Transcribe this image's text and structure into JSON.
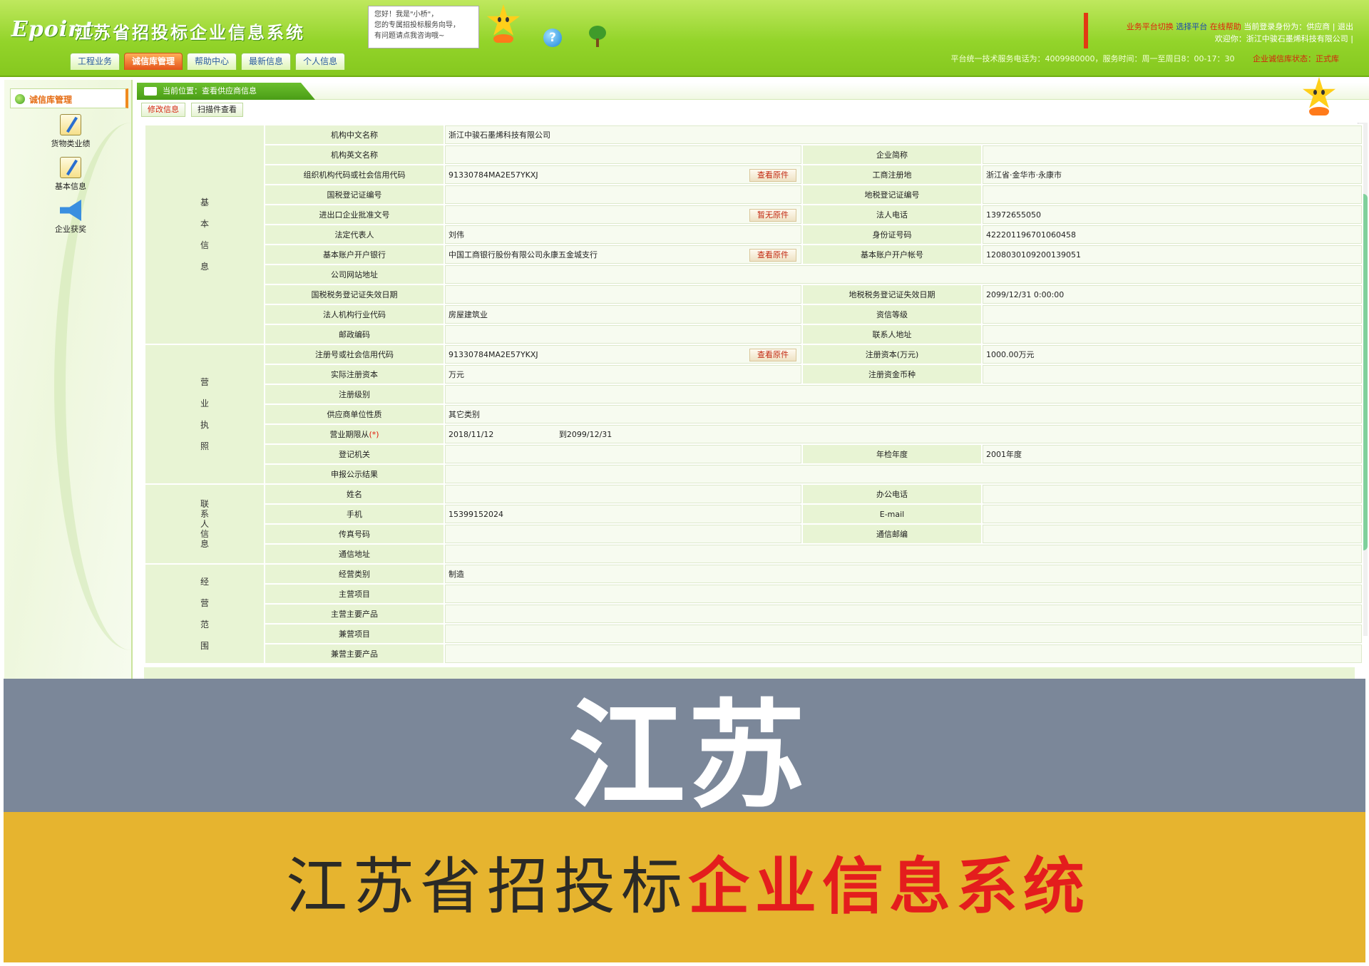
{
  "header": {
    "logo": "Epoint",
    "system_title": "江苏省招投标企业信息系统",
    "helper_bubble": [
      "您好！我是\"小桥\"，",
      "您的专属招投标服务向导，",
      "有问题请点我咨询哦~"
    ],
    "help_icon": "?",
    "top_links": {
      "switch_platform": "业务平台切换",
      "select_platform": "选择平台",
      "online_help": "在线帮助",
      "identity": "当前登录身份为：供应商",
      "logout": "退出",
      "welcome": "欢迎你：浙江中骏石墨烯科技有限公司"
    },
    "service_line": "平台统一技术服务电话为：4009980000，服务时间：周一至周日8：00-17：30",
    "credit_status": "企业诚信库状态：正式库",
    "tabs": [
      {
        "label": "工程业务",
        "active": false
      },
      {
        "label": "诚信库管理",
        "active": true
      },
      {
        "label": "帮助中心",
        "active": false
      },
      {
        "label": "最新信息",
        "active": false
      },
      {
        "label": "个人信息",
        "active": false
      }
    ]
  },
  "sidebar": {
    "title": "诚信库管理",
    "items": [
      {
        "label": "货物类业绩",
        "icon": "edit-note-icon"
      },
      {
        "label": "基本信息",
        "icon": "edit-note-icon"
      },
      {
        "label": "企业获奖",
        "icon": "megaphone-icon"
      }
    ]
  },
  "main": {
    "breadcrumb": "当前位置：查看供应商信息",
    "toolbar": {
      "edit": "修改信息",
      "scan": "扫描件查看"
    },
    "buttons": {
      "view_original": "查看原件",
      "no_original": "暂无原件"
    },
    "sections": {
      "basic": [
        "基",
        "本",
        "信",
        "息"
      ],
      "license": [
        "营",
        "业",
        "执",
        "照"
      ],
      "contact": [
        "联",
        "系",
        "人",
        "信",
        "息"
      ],
      "scope": [
        "经",
        "营",
        "范",
        "围"
      ]
    },
    "rows": {
      "cn_name": {
        "label": "机构中文名称",
        "value": "浙江中骏石墨烯科技有限公司"
      },
      "en_name": {
        "label": "机构英文名称",
        "value": ""
      },
      "short_name": {
        "label": "企业简称",
        "value": ""
      },
      "org_code": {
        "label": "组织机构代码或社会信用代码",
        "value": "91330784MA2E57YKXJ"
      },
      "reg_place": {
        "label": "工商注册地",
        "value": "浙江省·金华市·永康市"
      },
      "nat_tax": {
        "label": "国税登记证编号",
        "value": ""
      },
      "local_tax": {
        "label": "地税登记证编号",
        "value": ""
      },
      "import_export": {
        "label": "进出口企业批准文号",
        "value": ""
      },
      "legal_phone": {
        "label": "法人电话",
        "value": "13972655050"
      },
      "legal_rep": {
        "label": "法定代表人",
        "value": "刘伟"
      },
      "id_no": {
        "label": "身份证号码",
        "value": "422201196701060458"
      },
      "bank": {
        "label": "基本账户开户银行",
        "value": "中国工商银行股份有限公司永康五金城支行"
      },
      "bank_acct": {
        "label": "基本账户开户帐号",
        "value": "1208030109200139051"
      },
      "website": {
        "label": "公司网站地址",
        "value": ""
      },
      "nat_tax_exp": {
        "label": "国税税务登记证失效日期",
        "value": ""
      },
      "local_tax_exp": {
        "label": "地税税务登记证失效日期",
        "value": "2099/12/31 0:00:00"
      },
      "industry": {
        "label": "法人机构行业代码",
        "value": "房屋建筑业"
      },
      "qualification": {
        "label": "资信等级",
        "value": ""
      },
      "postcode": {
        "label": "邮政编码",
        "value": ""
      },
      "contact_addr": {
        "label": "联系人地址",
        "value": ""
      },
      "reg_no": {
        "label": "注册号或社会信用代码",
        "value": "91330784MA2E57YKXJ"
      },
      "reg_capital": {
        "label": "注册资本(万元)",
        "value": "1000.00万元"
      },
      "paid_capital": {
        "label": "实际注册资本",
        "value": "万元"
      },
      "currency": {
        "label": "注册资金币种",
        "value": ""
      },
      "reg_level": {
        "label": "注册级别",
        "value": ""
      },
      "unit_nature": {
        "label": "供应商单位性质",
        "value": "其它类别"
      },
      "term": {
        "label": "营业期限从",
        "required": "(*)",
        "from": "2018/11/12",
        "to": "到2099/12/31"
      },
      "reg_authority": {
        "label": "登记机关",
        "value": ""
      },
      "annual_check": {
        "label": "年检年度",
        "value": "2001年度"
      },
      "publicity": {
        "label": "申报公示结果",
        "value": ""
      },
      "contact_name": {
        "label": "姓名",
        "value": ""
      },
      "office_phone": {
        "label": "办公电话",
        "value": ""
      },
      "mobile": {
        "label": "手机",
        "value": "15399152024"
      },
      "email": {
        "label": "E-mail",
        "value": ""
      },
      "fax": {
        "label": "传真号码",
        "value": ""
      },
      "mail_code": {
        "label": "通信邮编",
        "value": ""
      },
      "mail_addr": {
        "label": "通信地址",
        "value": ""
      },
      "biz_type": {
        "label": "经营类别",
        "value": "制造"
      },
      "main_items": {
        "label": "主营项目",
        "value": ""
      },
      "main_products": {
        "label": "主营主要产品",
        "value": ""
      },
      "side_items": {
        "label": "兼营项目",
        "value": ""
      },
      "side_products": {
        "label": "兼营主要产品",
        "value": ""
      }
    }
  },
  "banner": {
    "big_text": "江苏",
    "tagline_plain": "江苏省招投标",
    "tagline_highlight": "企业信息系统"
  },
  "colors": {
    "header_green": "#93d42a",
    "active_tab": "#e5541b",
    "label_bg": "#e8f4d4",
    "band_gray": "#7b8799",
    "band_gold": "#e6b42f",
    "highlight_red": "#e41d1d"
  }
}
